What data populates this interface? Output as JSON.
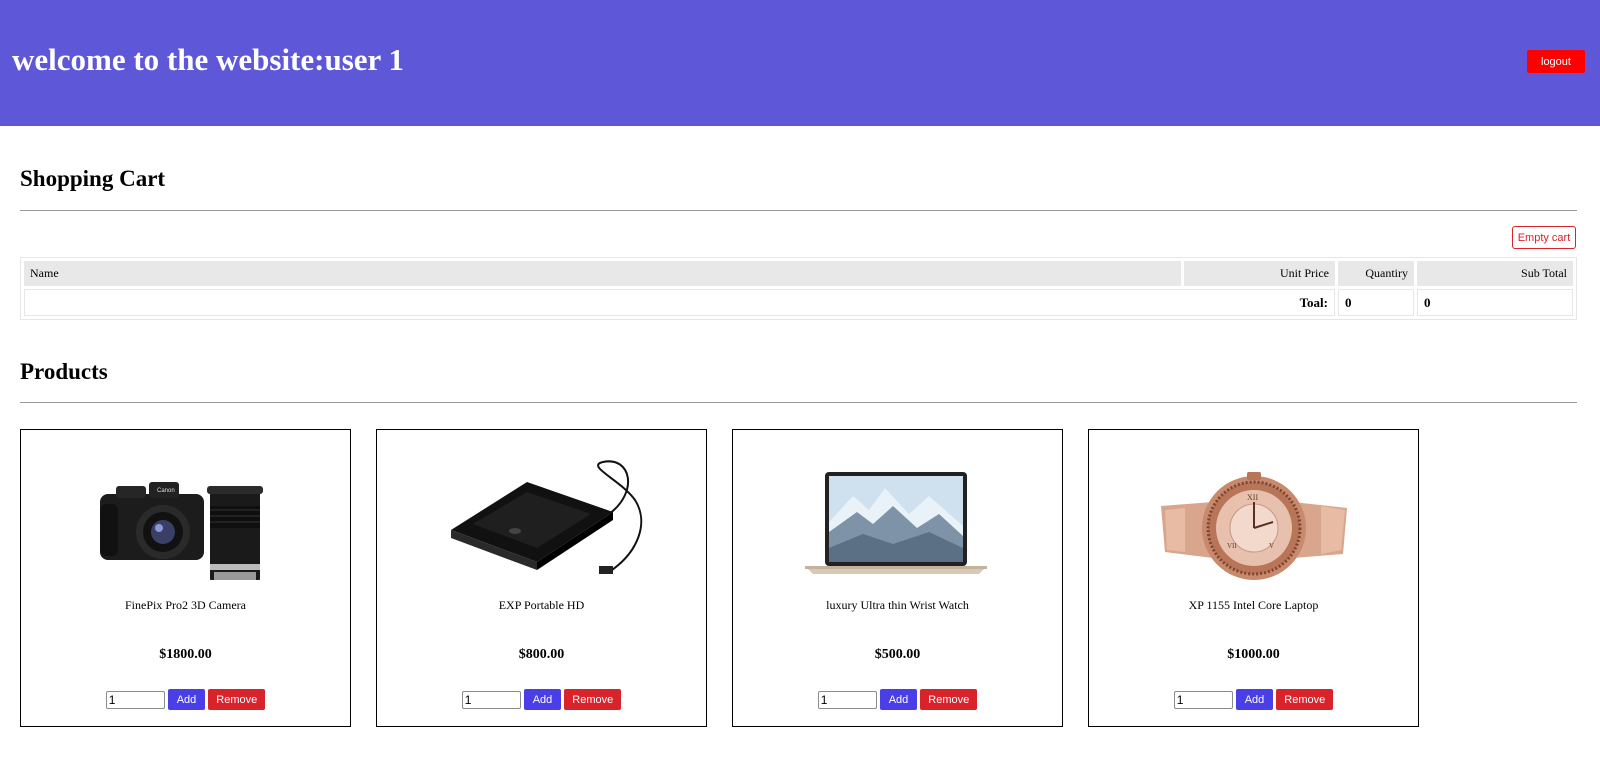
{
  "header": {
    "title": "welcome to the website:user 1",
    "logout_label": "logout"
  },
  "cart": {
    "title": "Shopping Cart",
    "empty_label": "Empty cart",
    "columns": {
      "name": "Name",
      "unit_price": "Unit Price",
      "quantity": "Quantiry",
      "subtotal": "Sub Total"
    },
    "total_label": "Toal:",
    "total_quantity": "0",
    "total_amount": "0"
  },
  "products": {
    "title": "Products",
    "items": [
      {
        "name": "FinePix Pro2 3D Camera",
        "price": "$1800.00",
        "qty": "1",
        "add_label": "Add",
        "remove_label": "Remove",
        "image": "camera-image"
      },
      {
        "name": "EXP Portable HD",
        "price": "$800.00",
        "qty": "1",
        "add_label": "Add",
        "remove_label": "Remove",
        "image": "hard-drive-image"
      },
      {
        "name": "luxury Ultra thin Wrist Watch",
        "price": "$500.00",
        "qty": "1",
        "add_label": "Add",
        "remove_label": "Remove",
        "image": "laptop-image"
      },
      {
        "name": "XP 1155 Intel Core Laptop",
        "price": "$1000.00",
        "qty": "1",
        "add_label": "Add",
        "remove_label": "Remove",
        "image": "wristwatch-image"
      }
    ]
  },
  "colors": {
    "header_bg": "#5e57d8",
    "logout_bg": "#ff0000",
    "add_bg": "#4a3fe6",
    "remove_bg": "#d8232a"
  }
}
